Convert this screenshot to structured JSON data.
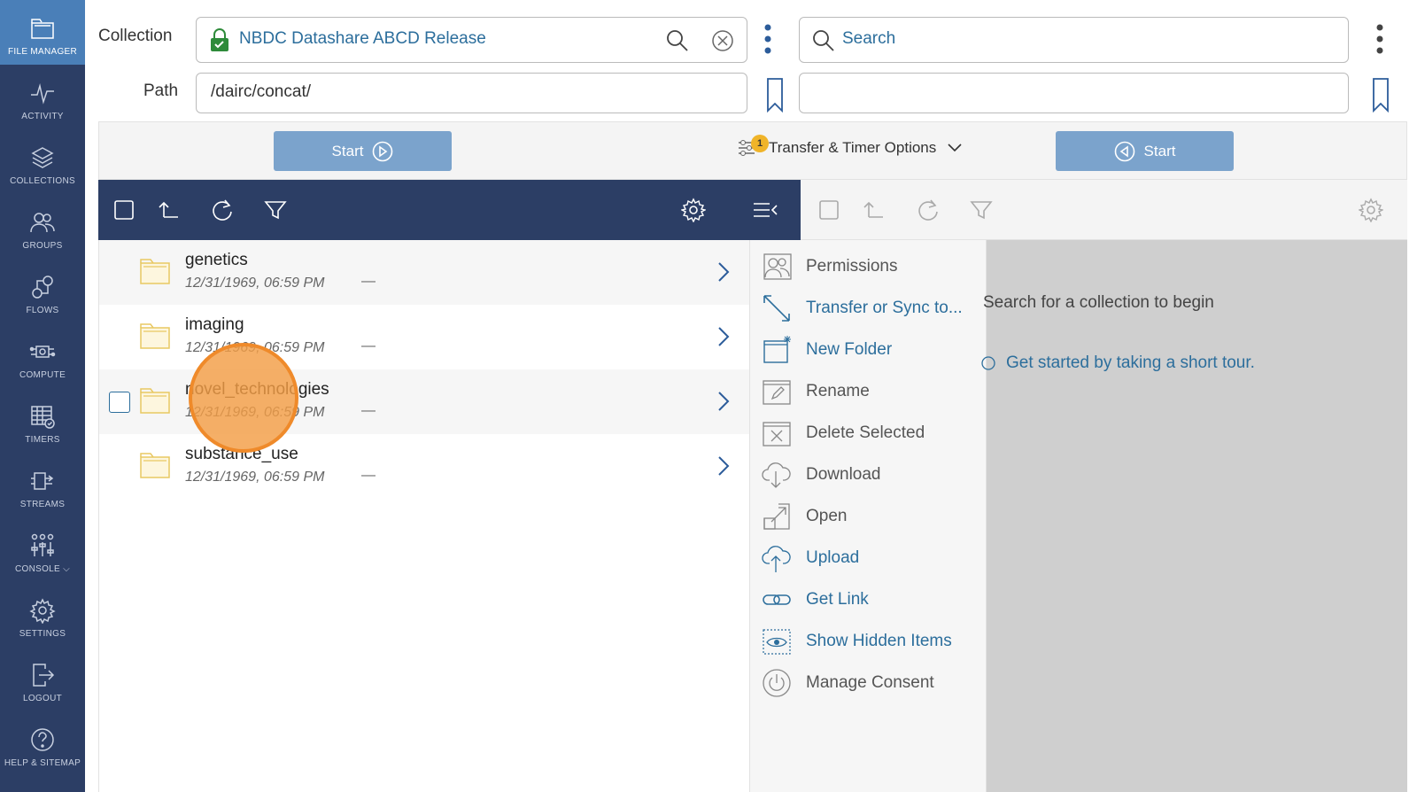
{
  "nav": {
    "items": [
      {
        "label": "FILE MANAGER",
        "icon": "folder-icon"
      },
      {
        "label": "ACTIVITY",
        "icon": "activity-icon"
      },
      {
        "label": "COLLECTIONS",
        "icon": "layers-icon"
      },
      {
        "label": "GROUPS",
        "icon": "users-icon"
      },
      {
        "label": "FLOWS",
        "icon": "flows-icon"
      },
      {
        "label": "COMPUTE",
        "icon": "compute-icon"
      },
      {
        "label": "TIMERS",
        "icon": "calendar-icon"
      },
      {
        "label": "STREAMS",
        "icon": "streams-icon"
      },
      {
        "label": "CONSOLE",
        "icon": "sliders-icon"
      },
      {
        "label": "SETTINGS",
        "icon": "gear-icon"
      },
      {
        "label": "LOGOUT",
        "icon": "logout-icon"
      },
      {
        "label": "HELP & SITEMAP",
        "icon": "help-icon"
      }
    ]
  },
  "top": {
    "collection_label": "Collection",
    "collection_value": "NBDC Datashare ABCD Release",
    "path_label": "Path",
    "path_value": "/dairc/concat/",
    "search_placeholder": "Search",
    "right_path_value": ""
  },
  "start_row": {
    "left_start": "Start",
    "right_start": "Start",
    "options_label": "Transfer & Timer Options",
    "options_badge": "1"
  },
  "files": [
    {
      "name": "genetics",
      "date": "12/31/1969, 06:59 PM",
      "size": "—"
    },
    {
      "name": "imaging",
      "date": "12/31/1969, 06:59 PM",
      "size": "—"
    },
    {
      "name": "novel_technologies",
      "date": "12/31/1969, 06:59 PM",
      "size": "—"
    },
    {
      "name": "substance_use",
      "date": "12/31/1969, 06:59 PM",
      "size": "—"
    }
  ],
  "menu": {
    "items": [
      {
        "label": "Permissions",
        "icon": "permissions-icon",
        "style": "grey"
      },
      {
        "label": "Transfer or Sync to...",
        "icon": "transfer-icon",
        "style": "blue"
      },
      {
        "label": "New Folder",
        "icon": "new-folder-icon",
        "style": "blue"
      },
      {
        "label": "Rename",
        "icon": "rename-icon",
        "style": "grey"
      },
      {
        "label": "Delete Selected",
        "icon": "delete-icon",
        "style": "grey"
      },
      {
        "label": "Download",
        "icon": "download-icon",
        "style": "grey"
      },
      {
        "label": "Open",
        "icon": "open-icon",
        "style": "grey"
      },
      {
        "label": "Upload",
        "icon": "upload-icon",
        "style": "blue"
      },
      {
        "label": "Get Link",
        "icon": "link-icon",
        "style": "blue"
      },
      {
        "label": "Show Hidden Items",
        "icon": "eye-icon",
        "style": "blue"
      },
      {
        "label": "Manage Consent",
        "icon": "power-icon",
        "style": "grey"
      }
    ]
  },
  "right_panel": {
    "message": "Search for a collection to begin",
    "tour_link": "Get started by taking a short tour."
  }
}
